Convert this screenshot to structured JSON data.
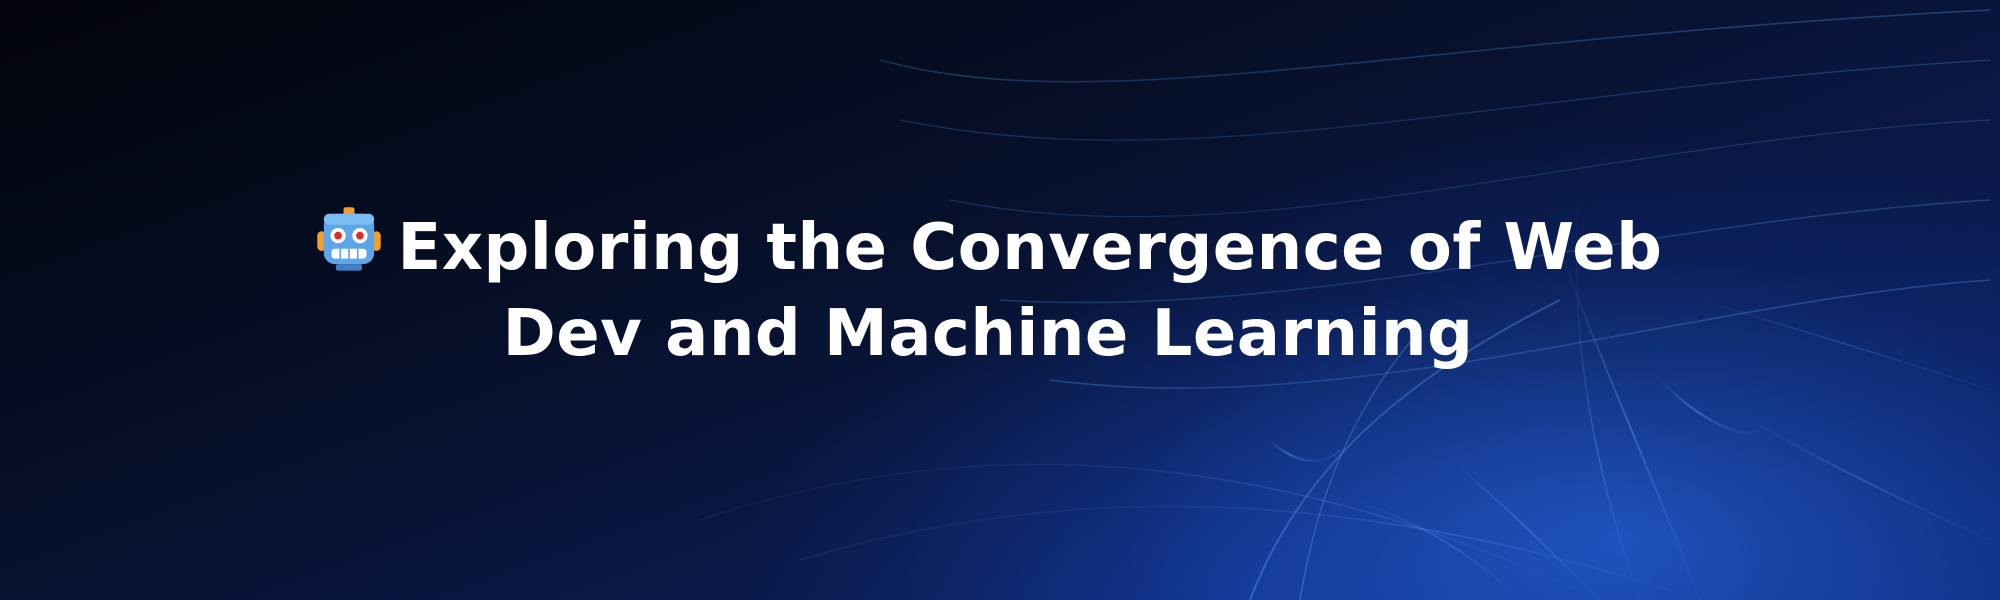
{
  "banner": {
    "title_line_1": "Exploring the Convergence of Web",
    "title_line_2": "Dev and Machine Learning",
    "icon": "robot-face-icon"
  },
  "colors": {
    "text": "#ffffff",
    "background_dark": "#03040b",
    "accent_blue": "#2c76ff"
  }
}
